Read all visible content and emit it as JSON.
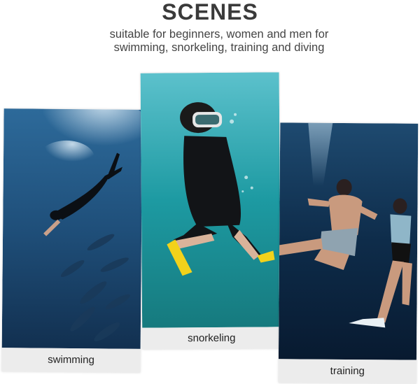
{
  "header": {
    "title": "SCENES",
    "subtitle_line1": "suitable for beginners, women and men for",
    "subtitle_line2": "swimming, snorkeling, training and diving"
  },
  "cards": [
    {
      "caption": "swimming"
    },
    {
      "caption": "snorkeling"
    },
    {
      "caption": "training"
    }
  ],
  "colors": {
    "title": "#3a3a3a",
    "caption_background": "#ececec",
    "water_swimming": "#1f4f7a",
    "water_snorkeling": "#1d8f96",
    "water_training": "#0e2c4a"
  }
}
